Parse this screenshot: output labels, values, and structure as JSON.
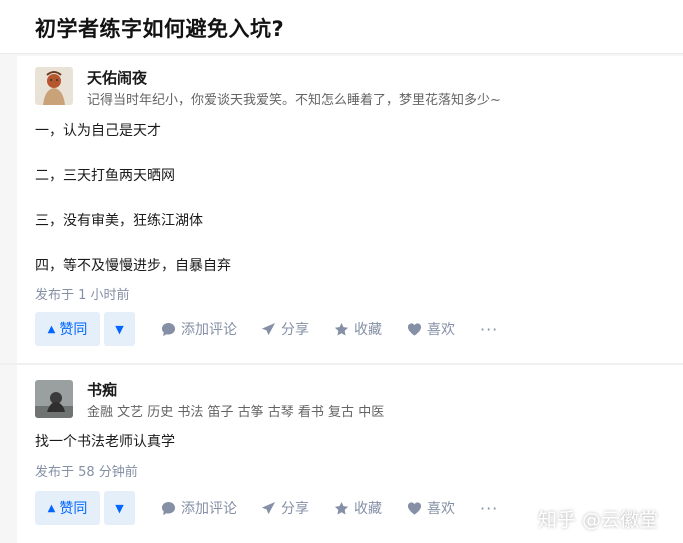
{
  "question": {
    "title": "初学者练字如何避免入坑?"
  },
  "answers": [
    {
      "author": {
        "name": "天佑闹夜",
        "bio": "记得当时年纪小，你爱谈天我爱笑。不知怎么睡着了，梦里花落知多少~"
      },
      "paragraphs": [
        "一，认为自己是天才",
        "二，三天打鱼两天晒网",
        "三，没有审美，狂练江湖体",
        "四，等不及慢慢进步，自暴自弃"
      ],
      "timestamp": "发布于 1 小时前",
      "actions": {
        "upvote": "赞同",
        "comment": "添加评论",
        "share": "分享",
        "favorite": "收藏",
        "like": "喜欢",
        "more": "···"
      }
    },
    {
      "author": {
        "name": "书痴",
        "bio": "金融 文艺 历史 书法 笛子 古筝 古琴 看书 复古 中医"
      },
      "paragraphs": [
        "找一个书法老师认真学"
      ],
      "timestamp": "发布于 58 分钟前",
      "actions": {
        "upvote": "赞同",
        "comment": "添加评论",
        "share": "分享",
        "favorite": "收藏",
        "like": "喜欢",
        "more": "···"
      }
    }
  ],
  "watermark": "知乎 @云徽堂",
  "colors": {
    "accent": "#0066ff",
    "accent_bg": "#e5effa",
    "muted": "#8590a6"
  }
}
